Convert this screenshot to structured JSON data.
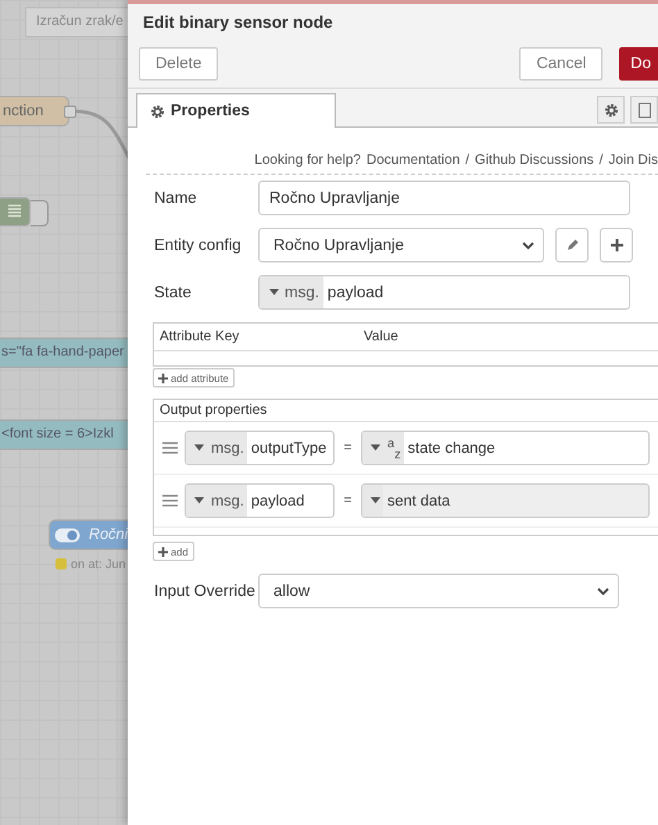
{
  "canvas": {
    "tab": "Izračun zrak/e",
    "nodes": [
      {
        "kind": "function",
        "label": "nction"
      },
      {
        "kind": "debug"
      },
      {
        "kind": "comment",
        "label": "s=\"fa fa-hand-paper"
      },
      {
        "kind": "comment",
        "label": "<font size = 6>Izkl"
      },
      {
        "kind": "switch",
        "label": "Ročni",
        "status": "on at: Jun"
      }
    ]
  },
  "tray": {
    "title": "Edit binary sensor node",
    "buttons": [
      {
        "kind": "delete",
        "label": "Delete"
      },
      {
        "kind": "cancel",
        "label": "Cancel"
      },
      {
        "kind": "done",
        "label": "Do"
      }
    ],
    "tabs": [
      {
        "label": "Properties",
        "selected": true
      }
    ],
    "help": {
      "lead": "Looking for help?",
      "separator": "/",
      "links": [
        "Documentation",
        "Github Discussions",
        "Join Dis"
      ]
    },
    "form": [
      {
        "kind": "text",
        "label": "Name",
        "value": "Ročno Upravljanje"
      },
      {
        "kind": "config",
        "label": "Entity config",
        "value": "Ročno Upravljanje"
      },
      {
        "kind": "typed",
        "label": "State",
        "type": "msg.",
        "value": "payload"
      },
      {
        "kind": "attributes",
        "columns": [
          "Attribute Key",
          "Value"
        ],
        "add": "add attribute"
      },
      {
        "kind": "outputs",
        "title": "Output properties",
        "rows": [
          {
            "type": "msg.",
            "property": "outputType",
            "op": "=",
            "value_type": "$^{a}$$_{z}$",
            "value": "state change",
            "readonly": false
          },
          {
            "type": "msg.",
            "property": "payload",
            "op": "=",
            "value": "sent data",
            "readonly": true
          }
        ],
        "add": "add"
      },
      {
        "kind": "select",
        "label": "Input Override",
        "value": "allow"
      }
    ]
  }
}
